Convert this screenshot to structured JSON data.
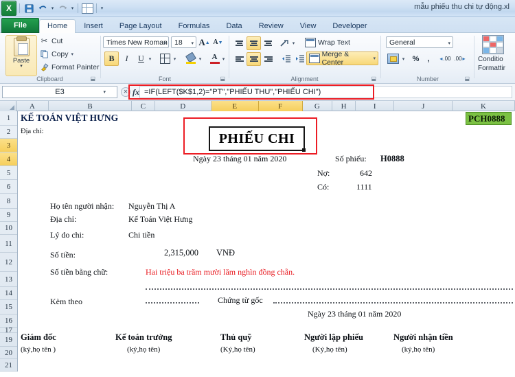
{
  "window": {
    "document_title": "mẫu phiếu thu chi tự động.xl"
  },
  "quick_access": {
    "save_icon": "save-icon",
    "undo_icon": "undo-icon",
    "redo_icon": "redo-icon",
    "table_icon": "table-icon",
    "customize_icon": "customize-qat-icon"
  },
  "ribbon": {
    "tabs": [
      {
        "label": "File",
        "id": "file"
      },
      {
        "label": "Home",
        "id": "home"
      },
      {
        "label": "Insert",
        "id": "insert"
      },
      {
        "label": "Page Layout",
        "id": "page-layout"
      },
      {
        "label": "Formulas",
        "id": "formulas"
      },
      {
        "label": "Data",
        "id": "data"
      },
      {
        "label": "Review",
        "id": "review"
      },
      {
        "label": "View",
        "id": "view"
      },
      {
        "label": "Developer",
        "id": "developer"
      }
    ],
    "active_tab": "Home",
    "clipboard": {
      "group_label": "Clipboard",
      "paste_label": "Paste",
      "cut_label": "Cut",
      "copy_label": "Copy",
      "format_painter_label": "Format Painter"
    },
    "font": {
      "group_label": "Font",
      "font_name": "Times New Roman",
      "font_size": "18",
      "grow_label": "A",
      "shrink_label": "A",
      "bold_label": "B",
      "italic_label": "I",
      "underline_label": "U",
      "borders_icon": "borders-icon",
      "fill_color_icon": "fill-color-icon",
      "font_color_icon": "font-color-icon"
    },
    "alignment": {
      "group_label": "Alignment",
      "wrap_text_label": "Wrap Text",
      "merge_center_label": "Merge & Center",
      "orientation_icon": "orientation-icon",
      "decrease_indent_icon": "decrease-indent-icon",
      "increase_indent_icon": "increase-indent-icon"
    },
    "number": {
      "group_label": "Number",
      "format": "General",
      "accounting_icon": "accounting-format-icon",
      "percent_label": "%",
      "comma_label": ",",
      "increase_decimal_label": ".00",
      "decrease_decimal_label": ".00"
    },
    "styles": {
      "conditional_line1": "Conditio",
      "conditional_line2": "Formattir"
    }
  },
  "formula_bar": {
    "name_box": "E3",
    "cancel_icon": "cancel-icon",
    "enter_icon": "enter-icon",
    "fx_label": "fx",
    "formula": "=IF(LEFT($K$1,2)=\"PT\",\"PHIẾU THU\",\"PHIẾU CHI\")"
  },
  "grid": {
    "columns": [
      "A",
      "B",
      "C",
      "D",
      "E",
      "F",
      "G",
      "H",
      "I",
      "J",
      "K"
    ],
    "selected_columns": [
      "E",
      "F"
    ],
    "rows": [
      "1",
      "2",
      "3",
      "4",
      "5",
      "6",
      "8",
      "9",
      "10",
      "11",
      "12",
      "13",
      "14",
      "15",
      "16",
      "17",
      "19",
      "20",
      "21"
    ],
    "selected_rows": [
      "3",
      "4"
    ],
    "cells": {
      "company": "KẾ TOÁN VIỆT HƯNG",
      "address_label_top": "Địa chỉ:",
      "voucher_code": "PCH0888",
      "voucher_title": "PHIẾU CHI",
      "date_line_top": "Ngày 23 tháng 01 năm 2020",
      "voucher_no_label": "Số phiếu:",
      "voucher_no_value": "H0888",
      "debit_label": "Nợ:",
      "debit_value": "642",
      "credit_label": "Có:",
      "credit_value": "1111",
      "receiver_label": "Họ tên người nhận:",
      "receiver_value": "Nguyễn Thị A",
      "address_label": "Địa chỉ:",
      "address_value": "Kế Toán Việt Hưng",
      "reason_label": "Lý do chi:",
      "reason_value": "Chi tiền",
      "amount_label": "Số tiền:",
      "amount_value": "2,315,000",
      "amount_currency": "VNĐ",
      "amount_words_label": "Số tiền bằng chữ:",
      "amount_words_value": "Hai triệu ba trăm mười lăm nghìn đồng chẵn.",
      "attachment_label": "Kèm theo",
      "attachment_value": "Chứng từ gốc",
      "date_line_bottom": "Ngày 23 tháng 01 năm 2020"
    },
    "signatures": [
      {
        "title": "Giám đốc",
        "sub": "(ký,họ tên )"
      },
      {
        "title": "Kế toán trưởng",
        "sub": "(ký,họ tên)"
      },
      {
        "title": "Thủ quỹ",
        "sub": "(Ký,họ tên)"
      },
      {
        "title": "Người lập phiếu",
        "sub": "(Ký,họ tên)"
      },
      {
        "title": "Người nhận tiền",
        "sub": "(ký,họ tên)"
      }
    ]
  },
  "colors": {
    "accent_green": "#1f7a3d",
    "highlight_yellow": "#f6cf5c",
    "annotation_red": "#ec1c24",
    "code_green": "#7bc143",
    "text_red": "#e8191f"
  }
}
